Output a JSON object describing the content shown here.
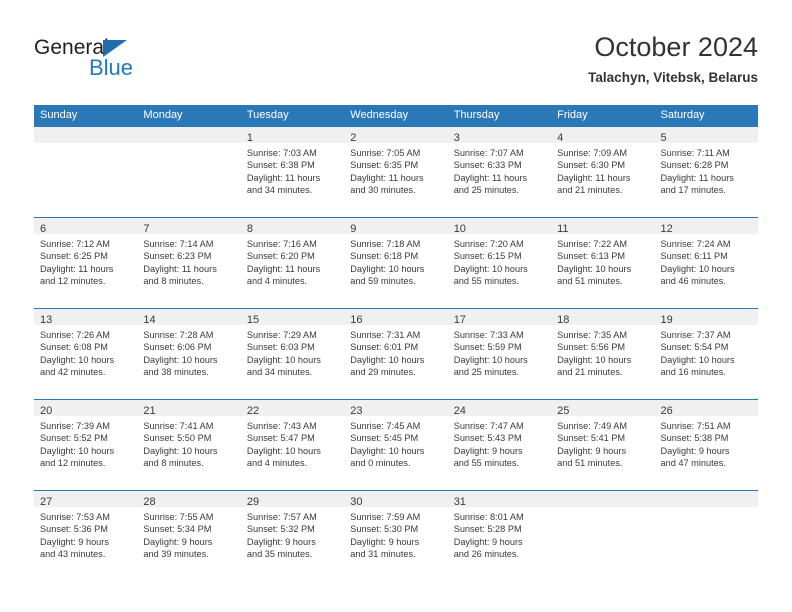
{
  "brand": {
    "name_top": "General",
    "name_bottom": "Blue",
    "triangle_color": "#1f6cb0",
    "blue_color": "#1f7ac4"
  },
  "header": {
    "title": "October 2024",
    "subtitle": "Talachyn, Vitebsk, Belarus"
  },
  "theme": {
    "header_bar_color": "#2b78b9",
    "day_band_color": "#f0f0f0",
    "text_color": "#3a3a3a"
  },
  "weekdays": [
    "Sunday",
    "Monday",
    "Tuesday",
    "Wednesday",
    "Thursday",
    "Friday",
    "Saturday"
  ],
  "weeks": [
    [
      {
        "day": "",
        "sunrise": "",
        "sunset": "",
        "daylight_1": "",
        "daylight_2": ""
      },
      {
        "day": "",
        "sunrise": "",
        "sunset": "",
        "daylight_1": "",
        "daylight_2": ""
      },
      {
        "day": "1",
        "sunrise": "Sunrise: 7:03 AM",
        "sunset": "Sunset: 6:38 PM",
        "daylight_1": "Daylight: 11 hours",
        "daylight_2": "and 34 minutes."
      },
      {
        "day": "2",
        "sunrise": "Sunrise: 7:05 AM",
        "sunset": "Sunset: 6:35 PM",
        "daylight_1": "Daylight: 11 hours",
        "daylight_2": "and 30 minutes."
      },
      {
        "day": "3",
        "sunrise": "Sunrise: 7:07 AM",
        "sunset": "Sunset: 6:33 PM",
        "daylight_1": "Daylight: 11 hours",
        "daylight_2": "and 25 minutes."
      },
      {
        "day": "4",
        "sunrise": "Sunrise: 7:09 AM",
        "sunset": "Sunset: 6:30 PM",
        "daylight_1": "Daylight: 11 hours",
        "daylight_2": "and 21 minutes."
      },
      {
        "day": "5",
        "sunrise": "Sunrise: 7:11 AM",
        "sunset": "Sunset: 6:28 PM",
        "daylight_1": "Daylight: 11 hours",
        "daylight_2": "and 17 minutes."
      }
    ],
    [
      {
        "day": "6",
        "sunrise": "Sunrise: 7:12 AM",
        "sunset": "Sunset: 6:25 PM",
        "daylight_1": "Daylight: 11 hours",
        "daylight_2": "and 12 minutes."
      },
      {
        "day": "7",
        "sunrise": "Sunrise: 7:14 AM",
        "sunset": "Sunset: 6:23 PM",
        "daylight_1": "Daylight: 11 hours",
        "daylight_2": "and 8 minutes."
      },
      {
        "day": "8",
        "sunrise": "Sunrise: 7:16 AM",
        "sunset": "Sunset: 6:20 PM",
        "daylight_1": "Daylight: 11 hours",
        "daylight_2": "and 4 minutes."
      },
      {
        "day": "9",
        "sunrise": "Sunrise: 7:18 AM",
        "sunset": "Sunset: 6:18 PM",
        "daylight_1": "Daylight: 10 hours",
        "daylight_2": "and 59 minutes."
      },
      {
        "day": "10",
        "sunrise": "Sunrise: 7:20 AM",
        "sunset": "Sunset: 6:15 PM",
        "daylight_1": "Daylight: 10 hours",
        "daylight_2": "and 55 minutes."
      },
      {
        "day": "11",
        "sunrise": "Sunrise: 7:22 AM",
        "sunset": "Sunset: 6:13 PM",
        "daylight_1": "Daylight: 10 hours",
        "daylight_2": "and 51 minutes."
      },
      {
        "day": "12",
        "sunrise": "Sunrise: 7:24 AM",
        "sunset": "Sunset: 6:11 PM",
        "daylight_1": "Daylight: 10 hours",
        "daylight_2": "and 46 minutes."
      }
    ],
    [
      {
        "day": "13",
        "sunrise": "Sunrise: 7:26 AM",
        "sunset": "Sunset: 6:08 PM",
        "daylight_1": "Daylight: 10 hours",
        "daylight_2": "and 42 minutes."
      },
      {
        "day": "14",
        "sunrise": "Sunrise: 7:28 AM",
        "sunset": "Sunset: 6:06 PM",
        "daylight_1": "Daylight: 10 hours",
        "daylight_2": "and 38 minutes."
      },
      {
        "day": "15",
        "sunrise": "Sunrise: 7:29 AM",
        "sunset": "Sunset: 6:03 PM",
        "daylight_1": "Daylight: 10 hours",
        "daylight_2": "and 34 minutes."
      },
      {
        "day": "16",
        "sunrise": "Sunrise: 7:31 AM",
        "sunset": "Sunset: 6:01 PM",
        "daylight_1": "Daylight: 10 hours",
        "daylight_2": "and 29 minutes."
      },
      {
        "day": "17",
        "sunrise": "Sunrise: 7:33 AM",
        "sunset": "Sunset: 5:59 PM",
        "daylight_1": "Daylight: 10 hours",
        "daylight_2": "and 25 minutes."
      },
      {
        "day": "18",
        "sunrise": "Sunrise: 7:35 AM",
        "sunset": "Sunset: 5:56 PM",
        "daylight_1": "Daylight: 10 hours",
        "daylight_2": "and 21 minutes."
      },
      {
        "day": "19",
        "sunrise": "Sunrise: 7:37 AM",
        "sunset": "Sunset: 5:54 PM",
        "daylight_1": "Daylight: 10 hours",
        "daylight_2": "and 16 minutes."
      }
    ],
    [
      {
        "day": "20",
        "sunrise": "Sunrise: 7:39 AM",
        "sunset": "Sunset: 5:52 PM",
        "daylight_1": "Daylight: 10 hours",
        "daylight_2": "and 12 minutes."
      },
      {
        "day": "21",
        "sunrise": "Sunrise: 7:41 AM",
        "sunset": "Sunset: 5:50 PM",
        "daylight_1": "Daylight: 10 hours",
        "daylight_2": "and 8 minutes."
      },
      {
        "day": "22",
        "sunrise": "Sunrise: 7:43 AM",
        "sunset": "Sunset: 5:47 PM",
        "daylight_1": "Daylight: 10 hours",
        "daylight_2": "and 4 minutes."
      },
      {
        "day": "23",
        "sunrise": "Sunrise: 7:45 AM",
        "sunset": "Sunset: 5:45 PM",
        "daylight_1": "Daylight: 10 hours",
        "daylight_2": "and 0 minutes."
      },
      {
        "day": "24",
        "sunrise": "Sunrise: 7:47 AM",
        "sunset": "Sunset: 5:43 PM",
        "daylight_1": "Daylight: 9 hours",
        "daylight_2": "and 55 minutes."
      },
      {
        "day": "25",
        "sunrise": "Sunrise: 7:49 AM",
        "sunset": "Sunset: 5:41 PM",
        "daylight_1": "Daylight: 9 hours",
        "daylight_2": "and 51 minutes."
      },
      {
        "day": "26",
        "sunrise": "Sunrise: 7:51 AM",
        "sunset": "Sunset: 5:38 PM",
        "daylight_1": "Daylight: 9 hours",
        "daylight_2": "and 47 minutes."
      }
    ],
    [
      {
        "day": "27",
        "sunrise": "Sunrise: 7:53 AM",
        "sunset": "Sunset: 5:36 PM",
        "daylight_1": "Daylight: 9 hours",
        "daylight_2": "and 43 minutes."
      },
      {
        "day": "28",
        "sunrise": "Sunrise: 7:55 AM",
        "sunset": "Sunset: 5:34 PM",
        "daylight_1": "Daylight: 9 hours",
        "daylight_2": "and 39 minutes."
      },
      {
        "day": "29",
        "sunrise": "Sunrise: 7:57 AM",
        "sunset": "Sunset: 5:32 PM",
        "daylight_1": "Daylight: 9 hours",
        "daylight_2": "and 35 minutes."
      },
      {
        "day": "30",
        "sunrise": "Sunrise: 7:59 AM",
        "sunset": "Sunset: 5:30 PM",
        "daylight_1": "Daylight: 9 hours",
        "daylight_2": "and 31 minutes."
      },
      {
        "day": "31",
        "sunrise": "Sunrise: 8:01 AM",
        "sunset": "Sunset: 5:28 PM",
        "daylight_1": "Daylight: 9 hours",
        "daylight_2": "and 26 minutes."
      },
      {
        "day": "",
        "sunrise": "",
        "sunset": "",
        "daylight_1": "",
        "daylight_2": ""
      },
      {
        "day": "",
        "sunrise": "",
        "sunset": "",
        "daylight_1": "",
        "daylight_2": ""
      }
    ]
  ]
}
